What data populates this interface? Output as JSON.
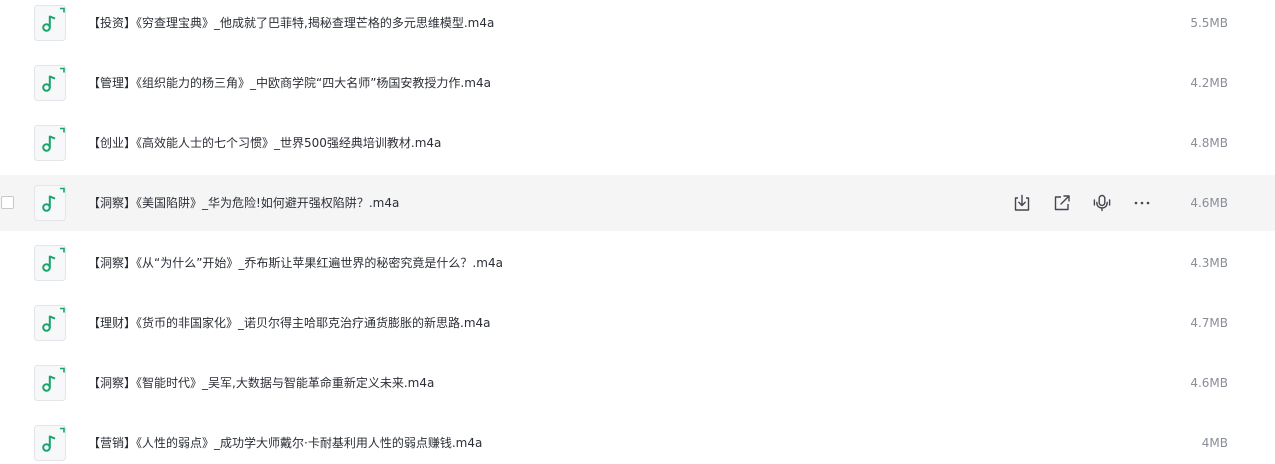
{
  "colors": {
    "accent_green": "#1aa36b",
    "hover_row": "#f5f5f6",
    "text": "#2b2f36",
    "muted": "#8a8e99"
  },
  "hovered_row_actions": [
    {
      "icon": "download-icon"
    },
    {
      "icon": "share-icon"
    },
    {
      "icon": "transcribe-icon"
    },
    {
      "icon": "more-icon"
    }
  ],
  "files": [
    {
      "icon": "music-note-icon",
      "name": "【投资】《穷查理宝典》_他成就了巴菲特,揭秘查理芒格的多元思维模型.m4a",
      "size": "5.5MB"
    },
    {
      "icon": "music-note-icon",
      "name": "【管理】《组织能力的杨三角》_中欧商学院“四大名师”杨国安教授力作.m4a",
      "size": "4.2MB"
    },
    {
      "icon": "music-note-icon",
      "name": "【创业】《高效能人士的七个习惯》_世界500强经典培训教材.m4a",
      "size": "4.8MB"
    },
    {
      "icon": "music-note-icon",
      "name": "【洞察】《美国陷阱》_华为危险!如何避开强权陷阱？.m4a",
      "size": "4.6MB",
      "hovered": true
    },
    {
      "icon": "music-note-icon",
      "name": "【洞察】《从“为什么”开始》_乔布斯让苹果红遍世界的秘密究竟是什么？.m4a",
      "size": "4.3MB"
    },
    {
      "icon": "music-note-icon",
      "name": "【理财】《货币的非国家化》_诺贝尔得主哈耶克治疗通货膨胀的新思路.m4a",
      "size": "4.7MB"
    },
    {
      "icon": "music-note-icon",
      "name": "【洞察】《智能时代》_吴军,大数据与智能革命重新定义未来.m4a",
      "size": "4.6MB"
    },
    {
      "icon": "music-note-icon",
      "name": "【营销】《人性的弱点》_成功学大师戴尔·卡耐基利用人性的弱点赚钱.m4a",
      "size": "4MB"
    }
  ]
}
